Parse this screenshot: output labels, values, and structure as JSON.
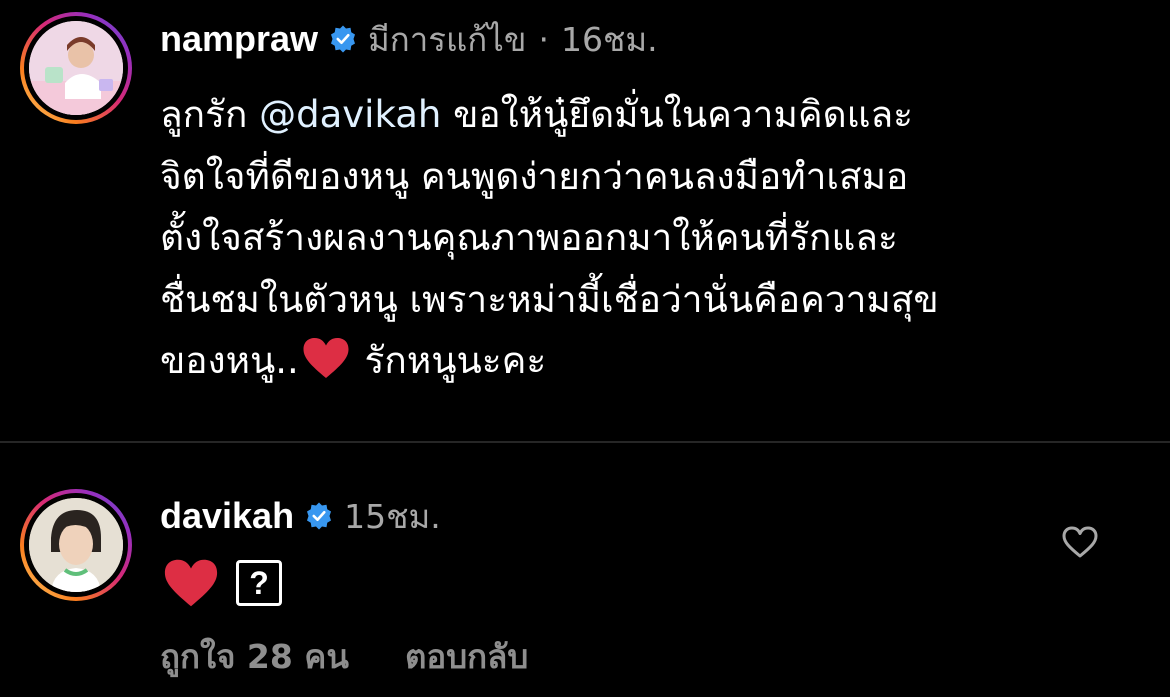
{
  "comments": [
    {
      "username": "nampraw",
      "edited_label": "มีการแก้ไข",
      "separator": "·",
      "time": "16ชม.",
      "lines": {
        "l1_pre": "ลูกรัก ",
        "l1_mention": "@davikah",
        "l1_post": " ขอให้นู๋ยึดมั่นในความคิดและ",
        "l2": "จิตใจที่ดีของหนู  คนพูดง่ายกว่าคนลงมือทำเสมอ",
        "l3": "ตั้งใจสร้างผลงานคุณภาพออกมาให้คนที่รักและ",
        "l4": "ชื่นชมในตัวหนู เพราะหม่ามี้เชื่อว่านั่นคือความสุข",
        "l5_pre": "ของหนู..",
        "l5_post": " รักหนูนะคะ"
      }
    },
    {
      "username": "davikah",
      "time": "15ชม.",
      "reply_glyph": "?",
      "likes_label": "ถูกใจ 28 คน",
      "reply_label": "ตอบกลับ"
    }
  ],
  "icons": {
    "verified": "verified-badge-icon",
    "heart_emoji": "red-heart-emoji",
    "like": "heart-outline-icon"
  },
  "colors": {
    "background": "#000000",
    "text": "#ffffff",
    "meta": "#a8a8a8",
    "verified_blue": "#3897f0",
    "mention": "#e0f1ff",
    "heart_red": "#dd2e44"
  }
}
